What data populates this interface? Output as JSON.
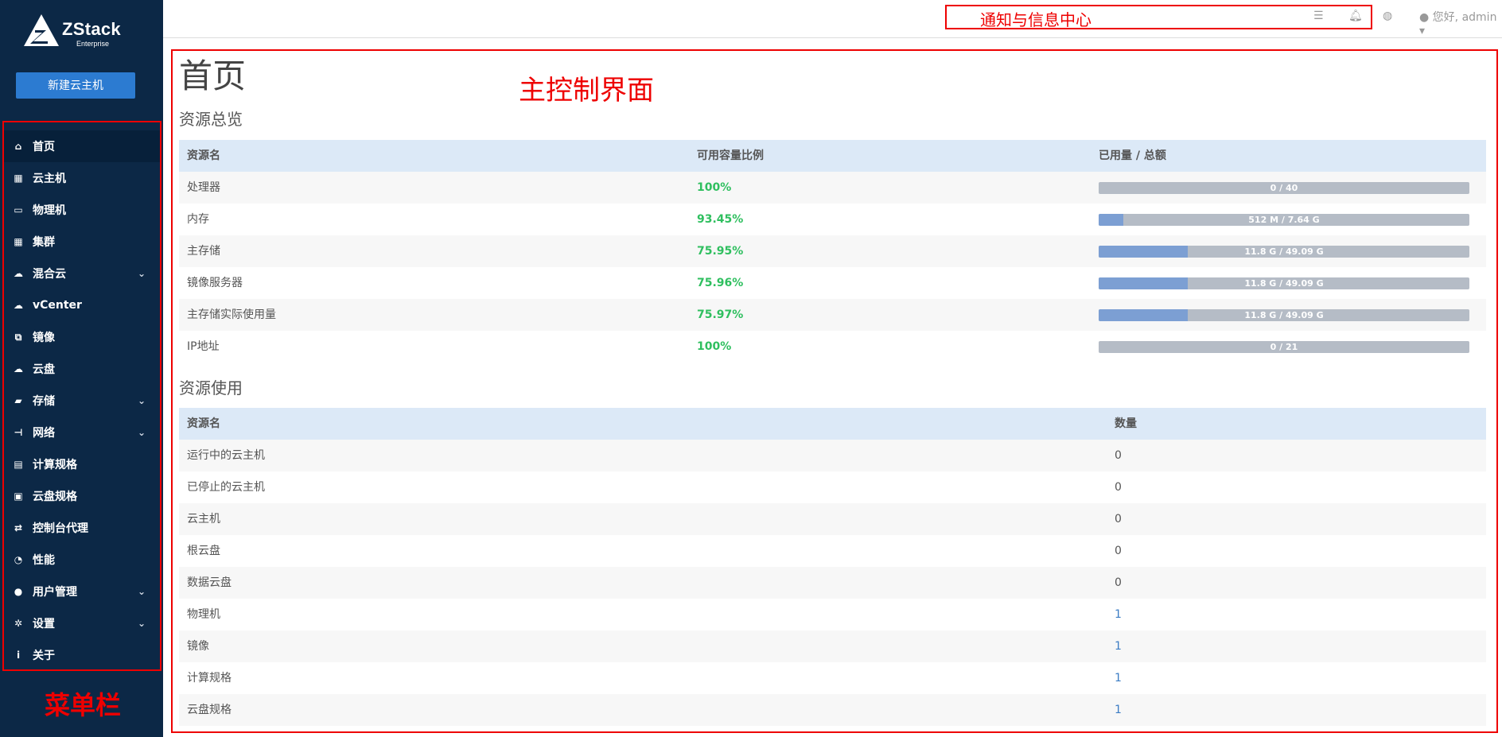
{
  "brand": {
    "name": "ZStack",
    "edition": "Enterprise"
  },
  "sidebar": {
    "new_vm_label": "新建云主机",
    "items": [
      {
        "label": "首页",
        "icon": "home-icon",
        "glyph": "⌂",
        "has_submenu": false,
        "active": true
      },
      {
        "label": "云主机",
        "icon": "grid-icon",
        "glyph": "▦",
        "has_submenu": false
      },
      {
        "label": "物理机",
        "icon": "monitor-icon",
        "glyph": "▭",
        "has_submenu": false
      },
      {
        "label": "集群",
        "icon": "cluster-icon",
        "glyph": "▦",
        "has_submenu": false
      },
      {
        "label": "混合云",
        "icon": "hybrid-cloud-icon",
        "glyph": "☁",
        "has_submenu": true
      },
      {
        "label": "vCenter",
        "icon": "cloud-icon",
        "glyph": "☁",
        "has_submenu": false
      },
      {
        "label": "镜像",
        "icon": "image-icon",
        "glyph": "⧉",
        "has_submenu": false
      },
      {
        "label": "云盘",
        "icon": "cloud-disk-icon",
        "glyph": "☁",
        "has_submenu": false
      },
      {
        "label": "存储",
        "icon": "storage-icon",
        "glyph": "▰",
        "has_submenu": true
      },
      {
        "label": "网络",
        "icon": "network-icon",
        "glyph": "⊣",
        "has_submenu": true
      },
      {
        "label": "计算规格",
        "icon": "calculator-icon",
        "glyph": "▤",
        "has_submenu": false
      },
      {
        "label": "云盘规格",
        "icon": "disk-spec-icon",
        "glyph": "▣",
        "has_submenu": false
      },
      {
        "label": "控制台代理",
        "icon": "exchange-icon",
        "glyph": "⇄",
        "has_submenu": false
      },
      {
        "label": "性能",
        "icon": "dashboard-icon",
        "glyph": "◔",
        "has_submenu": false
      },
      {
        "label": "用户管理",
        "icon": "user-icon",
        "glyph": "●",
        "has_submenu": true
      },
      {
        "label": "设置",
        "icon": "gear-icon",
        "glyph": "✲",
        "has_submenu": true
      },
      {
        "label": "关于",
        "icon": "info-icon",
        "glyph": "i",
        "has_submenu": false
      }
    ],
    "caption": "菜单栏"
  },
  "header": {
    "notify_caption": "通知与信息中心",
    "user_greeting": "您好, admin"
  },
  "main": {
    "title": "首页",
    "caption": "主控制界面",
    "overview": {
      "title": "资源总览",
      "columns": [
        "资源名",
        "可用容量比例",
        "已用量 / 总额"
      ],
      "rows": [
        {
          "name": "处理器",
          "pct": "100%",
          "usage": "0 / 40",
          "fill": 0.0
        },
        {
          "name": "内存",
          "pct": "93.45%",
          "usage": "512 M / 7.64 G",
          "fill": 0.0655
        },
        {
          "name": "主存储",
          "pct": "75.95%",
          "usage": "11.8 G / 49.09 G",
          "fill": 0.2405
        },
        {
          "name": "镜像服务器",
          "pct": "75.96%",
          "usage": "11.8 G / 49.09 G",
          "fill": 0.2404
        },
        {
          "name": "主存储实际使用量",
          "pct": "75.97%",
          "usage": "11.8 G / 49.09 G",
          "fill": 0.2403
        },
        {
          "name": "IP地址",
          "pct": "100%",
          "usage": "0 / 21",
          "fill": 0.0
        }
      ]
    },
    "usage": {
      "title": "资源使用",
      "columns": [
        "资源名",
        "数量"
      ],
      "rows": [
        {
          "name": "运行中的云主机",
          "count": "0"
        },
        {
          "name": "已停止的云主机",
          "count": "0"
        },
        {
          "name": "云主机",
          "count": "0"
        },
        {
          "name": "根云盘",
          "count": "0"
        },
        {
          "name": "数据云盘",
          "count": "0"
        },
        {
          "name": "物理机",
          "count": "1"
        },
        {
          "name": "镜像",
          "count": "1"
        },
        {
          "name": "计算规格",
          "count": "1"
        },
        {
          "name": "云盘规格",
          "count": "1"
        }
      ]
    }
  }
}
